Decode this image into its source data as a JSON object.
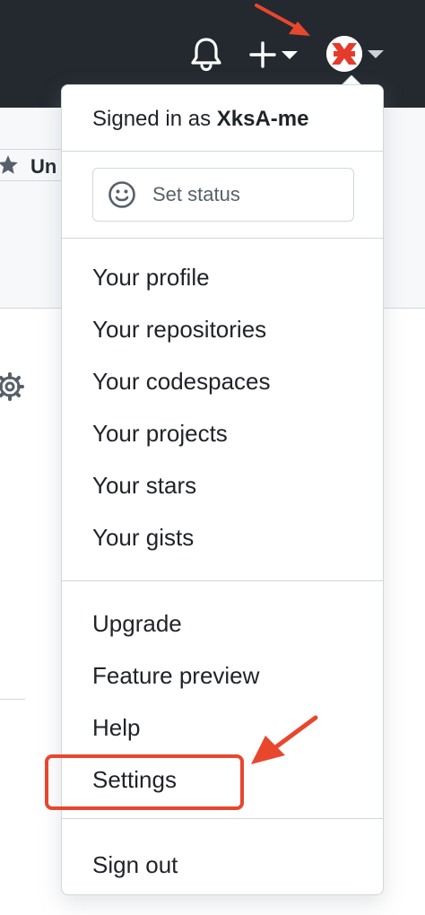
{
  "header": {
    "bell_icon": "bell-icon",
    "plus_icon": "plus-icon",
    "avatar_icon": "avatar-x-logo",
    "background_color": "#24292f"
  },
  "background": {
    "unstar_label": "Un"
  },
  "menu": {
    "signed_in_prefix": "Signed in as ",
    "username": "XksA-me",
    "set_status_label": "Set status",
    "profile_items": [
      "Your profile",
      "Your repositories",
      "Your codespaces",
      "Your projects",
      "Your stars",
      "Your gists"
    ],
    "secondary_items": [
      "Upgrade",
      "Feature preview",
      "Help",
      "Settings"
    ],
    "sign_out_label": "Sign out"
  },
  "annotation": {
    "highlight_color": "#e8472e",
    "highlighted_item": "Settings"
  }
}
